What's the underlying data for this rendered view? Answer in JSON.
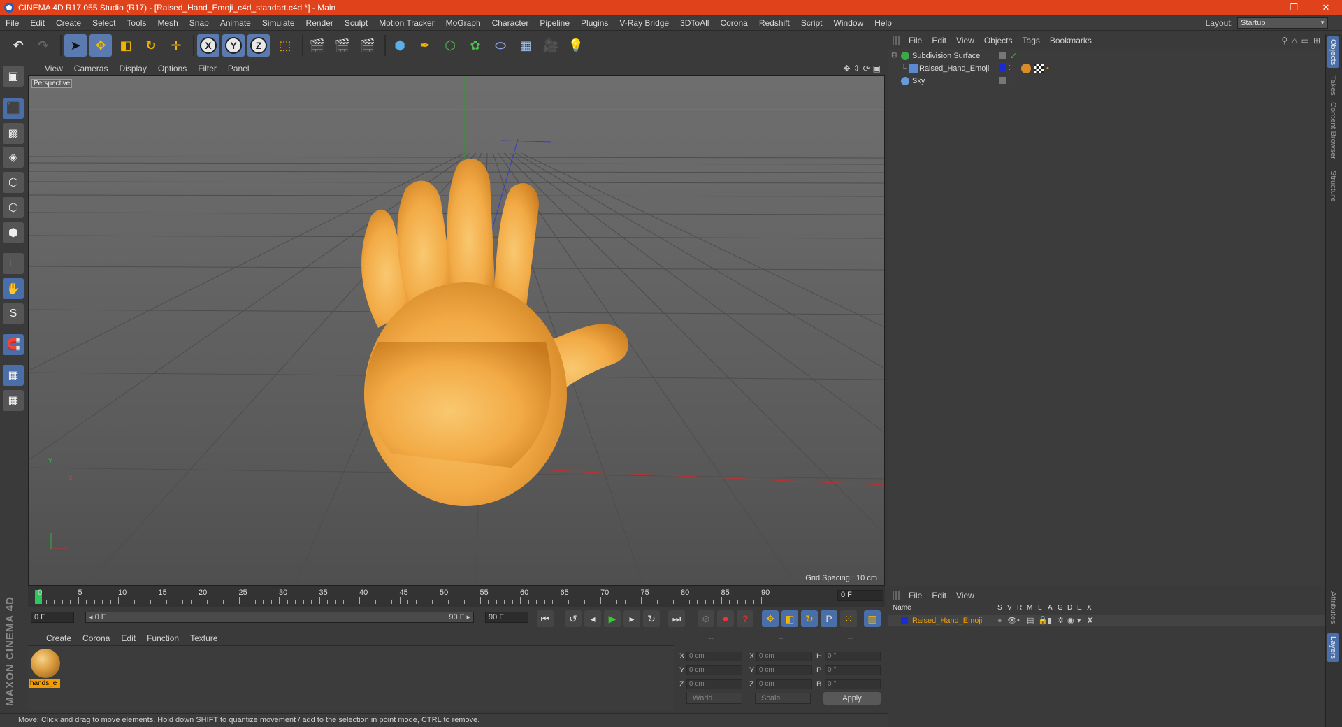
{
  "titlebar": {
    "title": "CINEMA 4D R17.055 Studio (R17) - [Raised_Hand_Emoji_c4d_standart.c4d *] - Main",
    "minimize": "—",
    "restore": "❐",
    "close": "✕"
  },
  "menubar": {
    "items": [
      "File",
      "Edit",
      "Create",
      "Select",
      "Tools",
      "Mesh",
      "Snap",
      "Animate",
      "Simulate",
      "Render",
      "Sculpt",
      "Motion Tracker",
      "MoGraph",
      "Character",
      "Pipeline",
      "Plugins",
      "V-Ray Bridge",
      "3DToAll",
      "Corona",
      "Redshift",
      "Script",
      "Window",
      "Help"
    ],
    "layout_label": "Layout:",
    "layout_value": "Startup"
  },
  "viewport": {
    "menu": [
      "View",
      "Cameras",
      "Display",
      "Options",
      "Filter",
      "Panel"
    ],
    "label": "Perspective",
    "grid_spacing": "Grid Spacing : 10 cm",
    "axis_x": "X",
    "axis_y": "Y"
  },
  "timeline": {
    "ticks": [
      "0",
      "5",
      "10",
      "15",
      "20",
      "25",
      "30",
      "35",
      "40",
      "45",
      "50",
      "55",
      "60",
      "65",
      "70",
      "75",
      "80",
      "85",
      "90"
    ],
    "current_frame": "0 F",
    "start_field": "0 F",
    "range_start": "◂ 0 F",
    "range_end": "90 F ▸",
    "end_field": "90 F"
  },
  "material_manager": {
    "menu": [
      "Create",
      "Corona",
      "Edit",
      "Function",
      "Texture"
    ],
    "material_name": "hands_e"
  },
  "coordinates": {
    "head": [
      "--",
      "--",
      "--"
    ],
    "rows": [
      {
        "a": "X",
        "av": "0 cm",
        "b": "X",
        "bv": "0 cm",
        "c": "H",
        "cv": "0 °"
      },
      {
        "a": "Y",
        "av": "0 cm",
        "b": "Y",
        "bv": "0 cm",
        "c": "P",
        "cv": "0 °"
      },
      {
        "a": "Z",
        "av": "0 cm",
        "b": "Z",
        "bv": "0 cm",
        "c": "B",
        "cv": "0 °"
      }
    ],
    "world": "World",
    "scale": "Scale",
    "apply": "Apply"
  },
  "brand": {
    "logo": "MAXON CINEMA 4D"
  },
  "statusbar": {
    "text": "Move: Click and drag to move elements. Hold down SHIFT to quantize movement / add to the selection in point mode, CTRL to remove."
  },
  "object_manager": {
    "menu": [
      "File",
      "Edit",
      "View",
      "Objects",
      "Tags",
      "Bookmarks"
    ],
    "objects": [
      {
        "name": "Subdivision Surface",
        "color": "#3da84a"
      },
      {
        "name": "Raised_Hand_Emoji",
        "color": "#5a8ad0"
      },
      {
        "name": "Sky",
        "color": "#6a9ad8"
      }
    ]
  },
  "layer_manager": {
    "menu": [
      "File",
      "Edit",
      "View"
    ],
    "columns": [
      "Name",
      "S",
      "V",
      "R",
      "M",
      "L",
      "A",
      "G",
      "D",
      "E",
      "X"
    ],
    "layer_name": "Raised_Hand_Emoji"
  },
  "right_tabs": [
    "Objects",
    "Takes",
    "Content Browser",
    "Structure",
    "Attributes",
    "Layers"
  ],
  "colors": {
    "accent": "#4a6fa8",
    "titlebar": "#e0431b",
    "material_label": "#f29c00",
    "layer_text": "#f2a000"
  }
}
